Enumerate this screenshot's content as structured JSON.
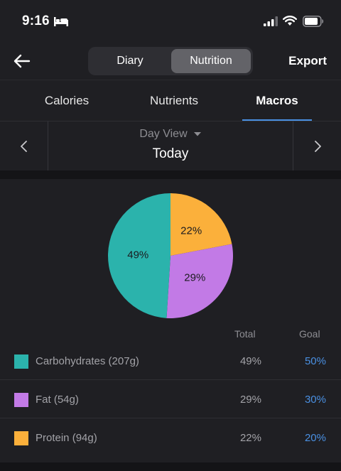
{
  "status": {
    "time": "9:16"
  },
  "nav": {
    "segments": [
      "Diary",
      "Nutrition"
    ],
    "selected_segment": "Nutrition",
    "export_label": "Export"
  },
  "tabs": [
    {
      "label": "Calories",
      "active": false
    },
    {
      "label": "Nutrients",
      "active": false
    },
    {
      "label": "Macros",
      "active": true
    }
  ],
  "date": {
    "view_label": "Day View",
    "date_label": "Today"
  },
  "table": {
    "total_header": "Total",
    "goal_header": "Goal",
    "rows": [
      {
        "name": "Carbohydrates (207g)",
        "total": "49%",
        "goal": "50%",
        "color": "#2bb3ac"
      },
      {
        "name": "Fat (54g)",
        "total": "29%",
        "goal": "30%",
        "color": "#c27ae6"
      },
      {
        "name": "Protein (94g)",
        "total": "22%",
        "goal": "20%",
        "color": "#fbb03b"
      }
    ]
  },
  "chart_data": {
    "type": "pie",
    "slices": [
      {
        "label": "22%",
        "value": 22,
        "color": "#fbb03b"
      },
      {
        "label": "29%",
        "value": 29,
        "color": "#c27ae6"
      },
      {
        "label": "49%",
        "value": 49,
        "color": "#2bb3ac"
      }
    ]
  },
  "colors": {
    "accent": "#4a90e2",
    "background": "#1f1f23"
  }
}
